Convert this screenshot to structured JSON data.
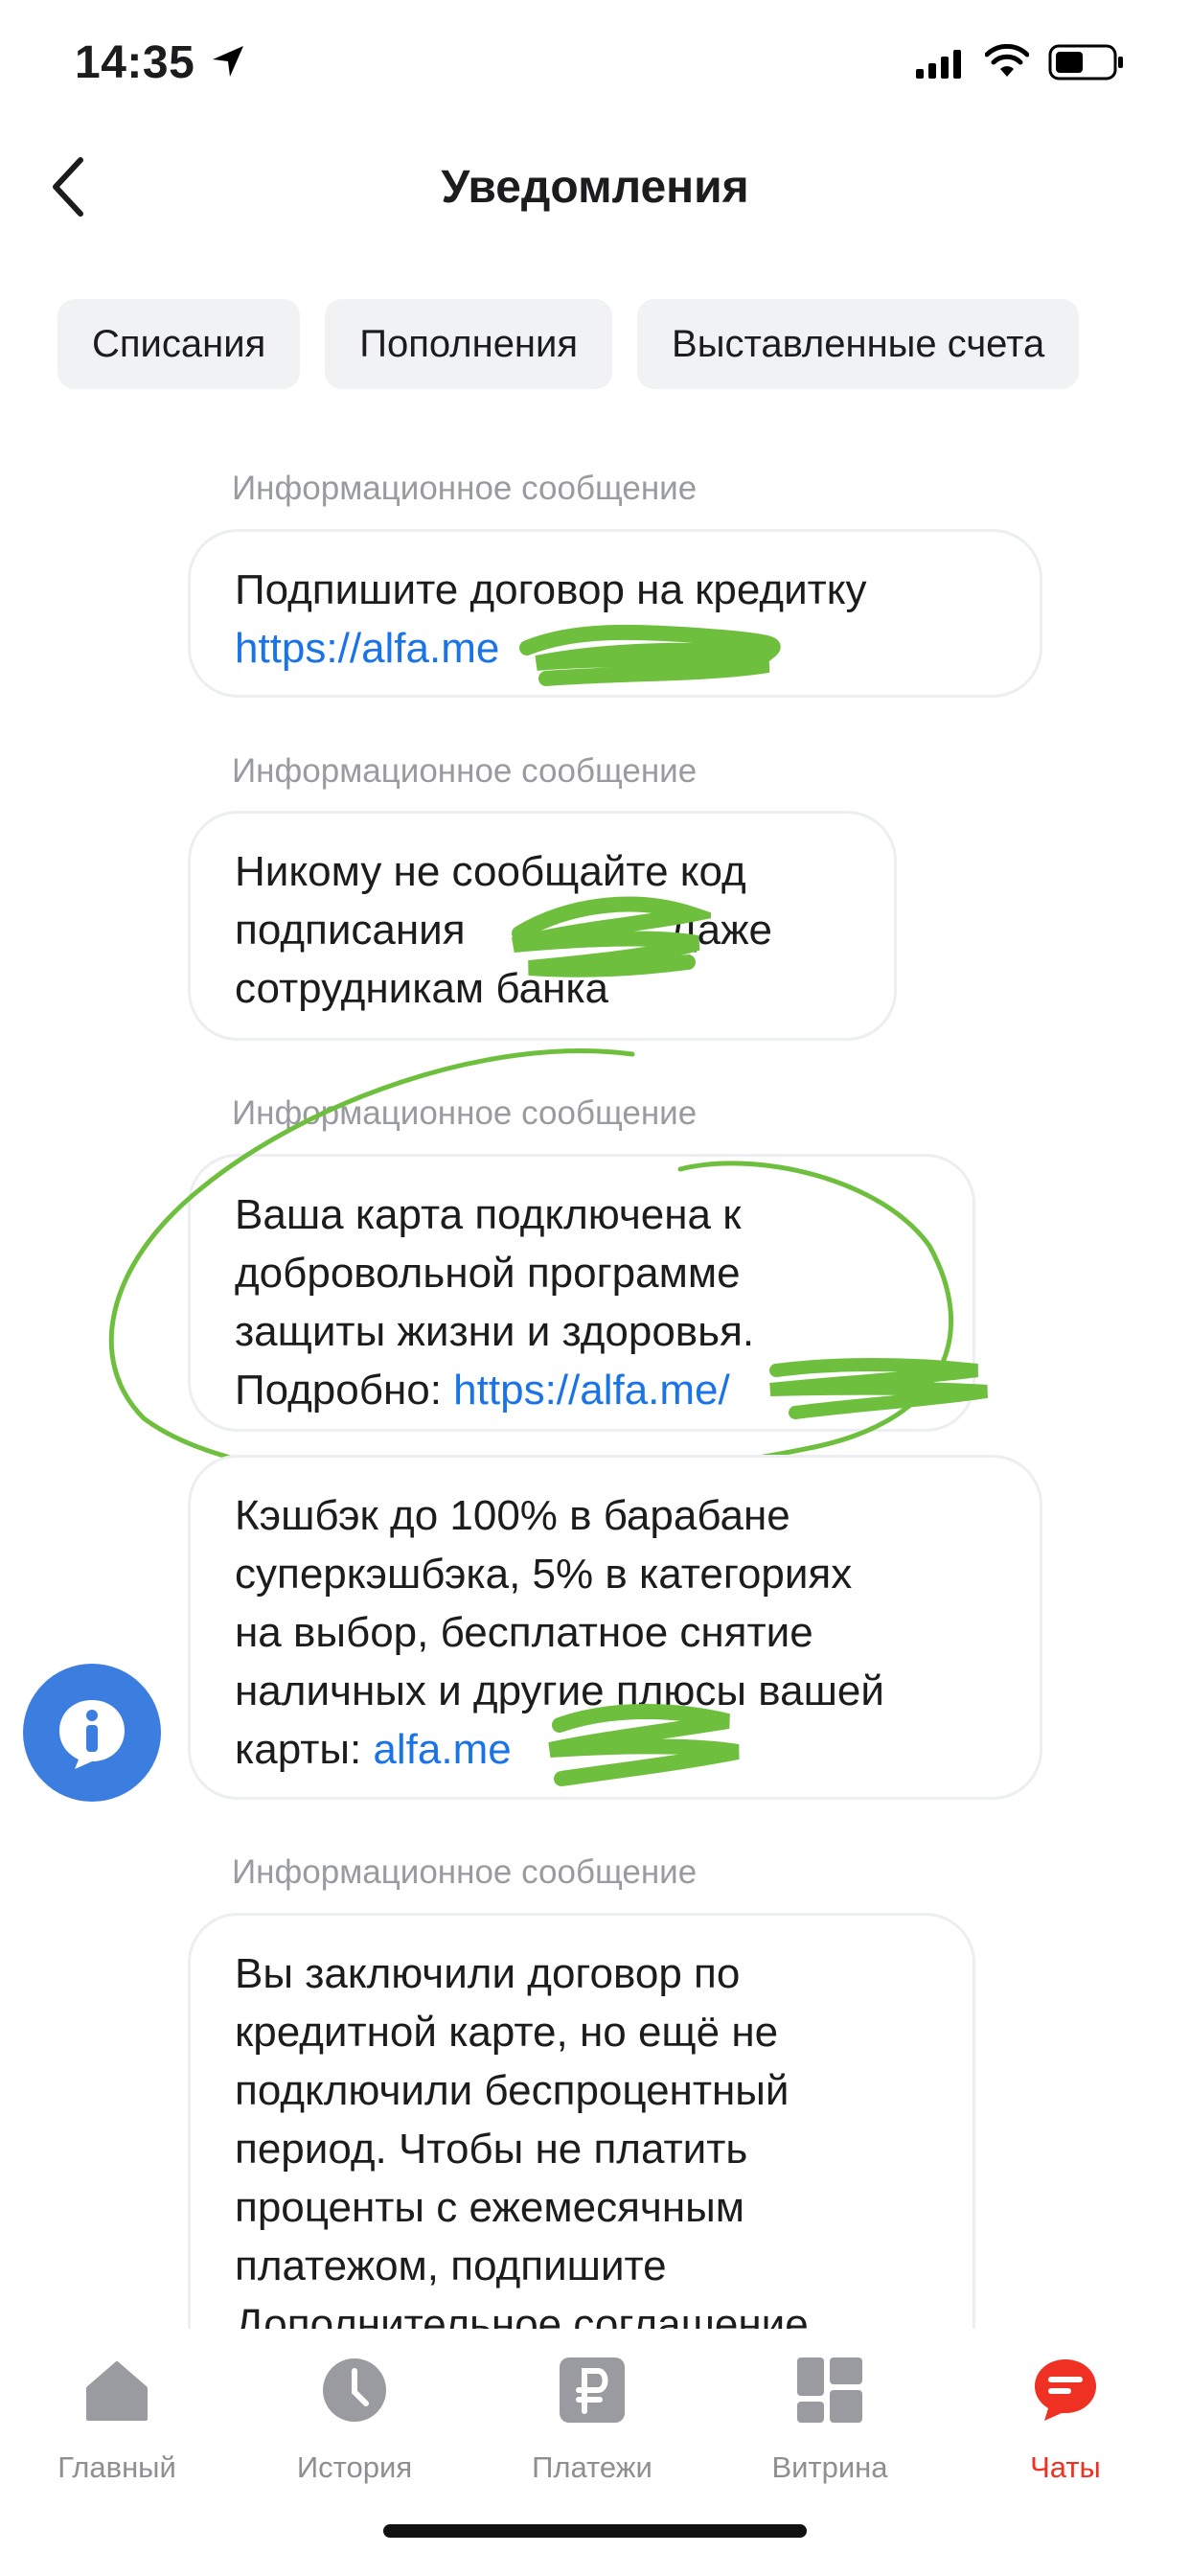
{
  "status_bar": {
    "time": "14:35"
  },
  "header": {
    "title": "Уведомления"
  },
  "filters": [
    "Списания",
    "Пополнения",
    "Выставленные счета"
  ],
  "messages": [
    {
      "label": "Информационное сообщение",
      "text": "Подпишите договор на кредитку ",
      "link": "https://alfa.me"
    },
    {
      "label": "Информационное сообщение",
      "text1": "Никому не сообщайте код",
      "text2": "подписания ",
      "text3": "Даже",
      "text4": "сотрудникам банка"
    },
    {
      "label": "Информационное сообщение",
      "l1": "Ваша карта подключена к",
      "l2": "добровольной программе",
      "l3": "защиты жизни и здоровья.",
      "l4": "Подробно: ",
      "link": "https://alfa.me/"
    },
    {
      "l1": "Кэшбэк до 100% в барабане",
      "l2": "суперкэшбэка, 5% в категориях",
      "l3": "на выбор, бесплатное снятие",
      "l4": "наличных и другие плюсы вашей",
      "l5": "карты: ",
      "link": "alfa.me"
    },
    {
      "label": "Информационное сообщение",
      "l1": "Вы заключили договор по",
      "l2": "кредитной карте, но ещё не",
      "l3": "подключили беспроцентный",
      "l4": "период. Чтобы не платить",
      "l5": "проценты с ежемесячным",
      "l6": "платежом, подпишите",
      "l7": "Дополнительное соглашение."
    }
  ],
  "tabs": [
    {
      "label": "Главный",
      "icon": "home-icon"
    },
    {
      "label": "История",
      "icon": "clock-icon"
    },
    {
      "label": "Платежи",
      "icon": "ruble-icon"
    },
    {
      "label": "Витрина",
      "icon": "grid-icon"
    },
    {
      "label": "Чаты",
      "icon": "chat-icon"
    }
  ],
  "colors": {
    "accent": "#ef3124",
    "link": "#1a74e8",
    "scribble": "#6fbf3f",
    "fab": "#3b7ee0"
  }
}
